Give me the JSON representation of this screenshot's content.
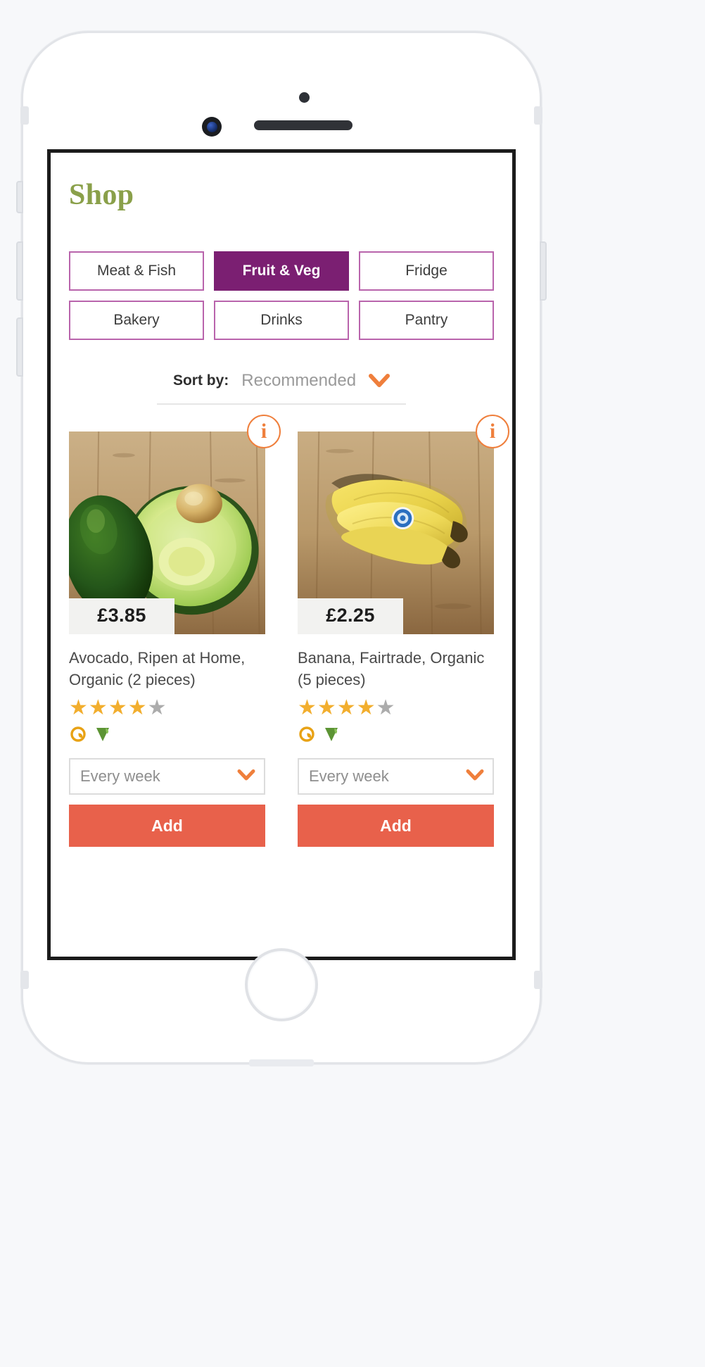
{
  "app": {
    "screen_title": "Shop"
  },
  "categories": [
    {
      "label": "Meat & Fish",
      "active": false
    },
    {
      "label": "Fruit & Veg",
      "active": true
    },
    {
      "label": "Fridge",
      "active": false
    },
    {
      "label": "Bakery",
      "active": false
    },
    {
      "label": "Drinks",
      "active": false
    },
    {
      "label": "Pantry",
      "active": false
    }
  ],
  "sort": {
    "label": "Sort by:",
    "value": "Recommended",
    "chevron_icon": "chevron-down-icon",
    "chevron_color": "#ef7f3c"
  },
  "products": [
    {
      "info_icon": "i",
      "image_alt": "avocado-photo",
      "price": "£3.85",
      "name": "Avocado, Ripen at Home, Organic (2 pieces)",
      "rating": 4,
      "rating_max": 5,
      "badges": [
        "organic-icon",
        "vegan-icon"
      ],
      "frequency": "Every week",
      "frequency_chevron_icon": "chevron-down-icon",
      "add_label": "Add"
    },
    {
      "info_icon": "i",
      "image_alt": "banana-photo",
      "price": "£2.25",
      "name": "Banana, Fairtrade, Organic (5 pieces)",
      "rating": 4,
      "rating_max": 5,
      "badges": [
        "organic-icon",
        "vegan-icon"
      ],
      "frequency": "Every week",
      "frequency_chevron_icon": "chevron-down-icon",
      "add_label": "Add"
    }
  ],
  "colors": {
    "title_green": "#8aa04a",
    "category_purple": "#7b1f72",
    "category_border": "#b964ac",
    "accent_orange": "#ef7f3c",
    "add_button": "#e8614b",
    "star_gold": "#f2ae2e",
    "star_grey": "#acacac"
  }
}
